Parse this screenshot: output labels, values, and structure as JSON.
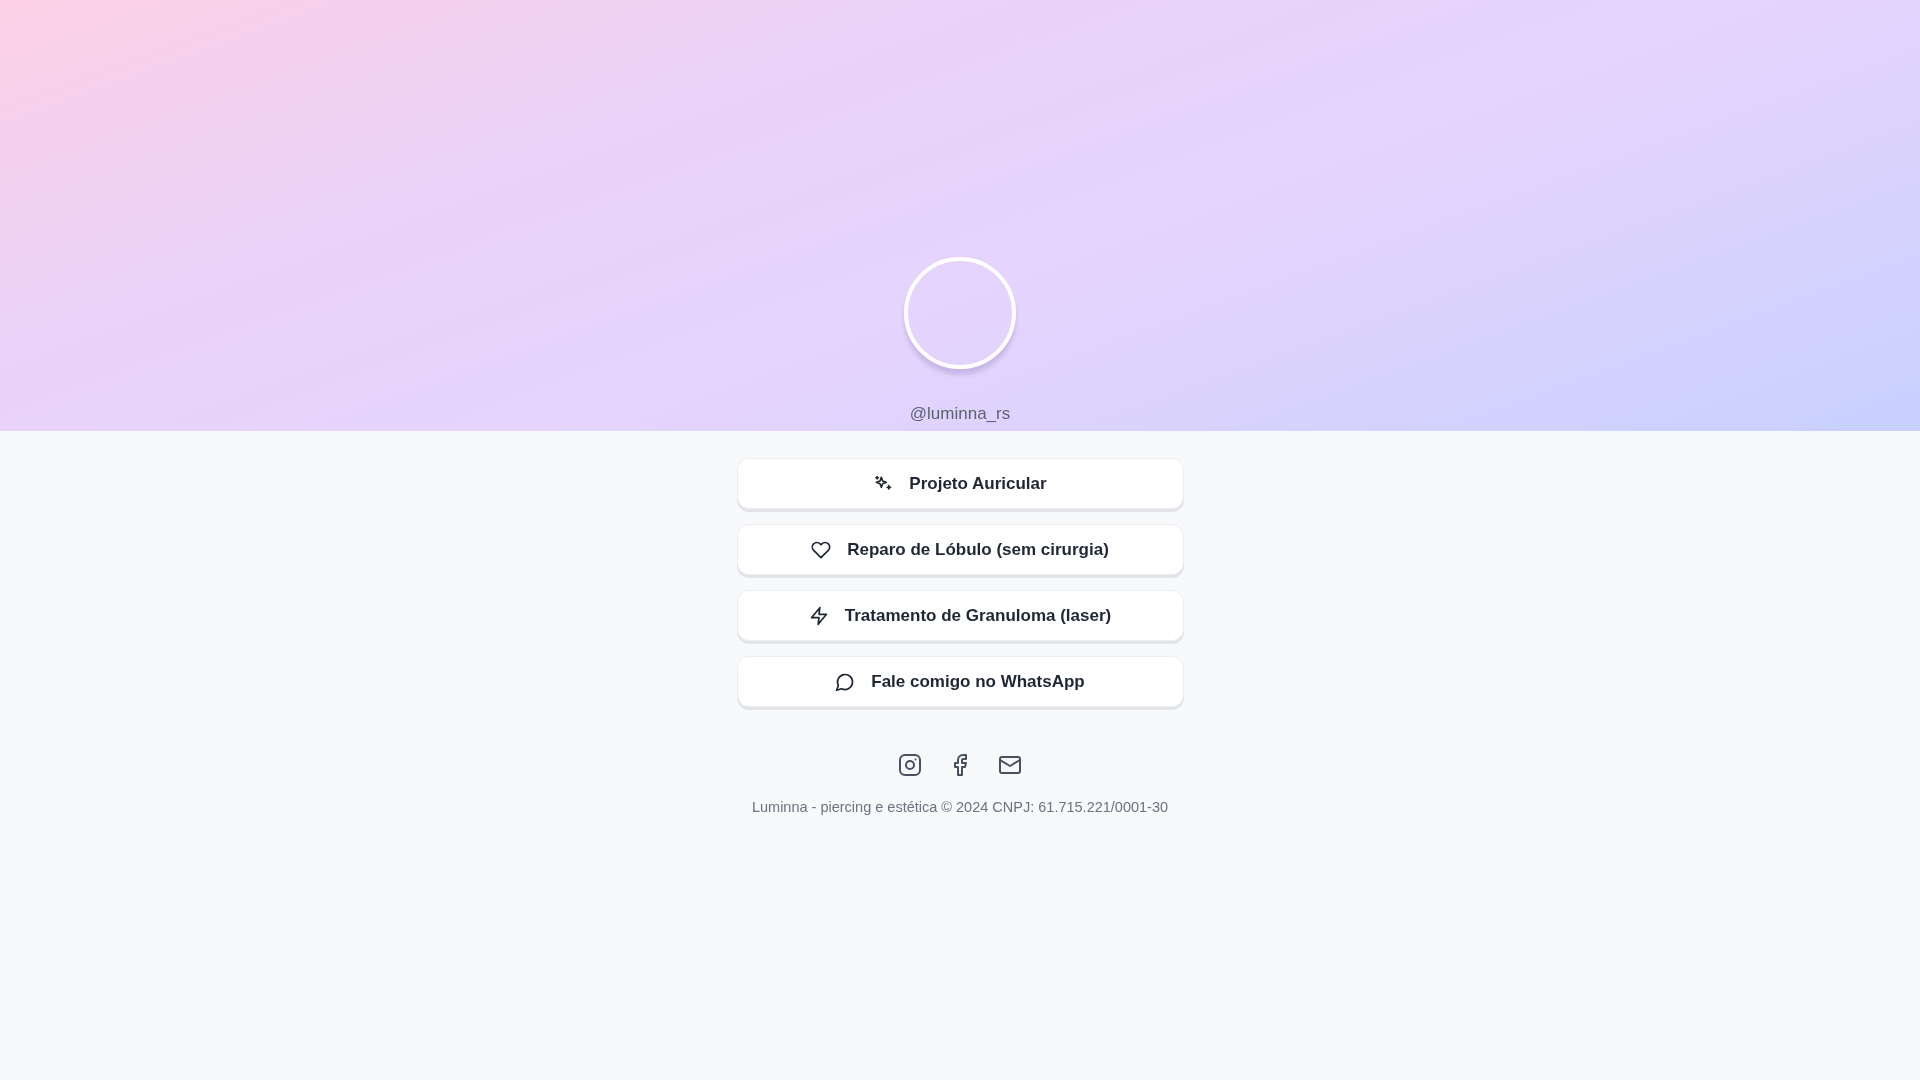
{
  "profile": {
    "handle": "@luminna_rs"
  },
  "links": [
    {
      "kind": "sparkles",
      "label": "Projeto Auricular"
    },
    {
      "kind": "heart",
      "label": "Reparo de Lóbulo (sem cirurgia)"
    },
    {
      "kind": "bolt",
      "label": "Tratamento de Granuloma (laser)"
    },
    {
      "kind": "chat",
      "label": "Fale comigo no WhatsApp"
    }
  ],
  "social": [
    {
      "kind": "instagram"
    },
    {
      "kind": "facebook"
    },
    {
      "kind": "mail"
    }
  ],
  "footer": "Luminna - piercing e estética © 2024 CNPJ: 61.715.221/0001-30"
}
